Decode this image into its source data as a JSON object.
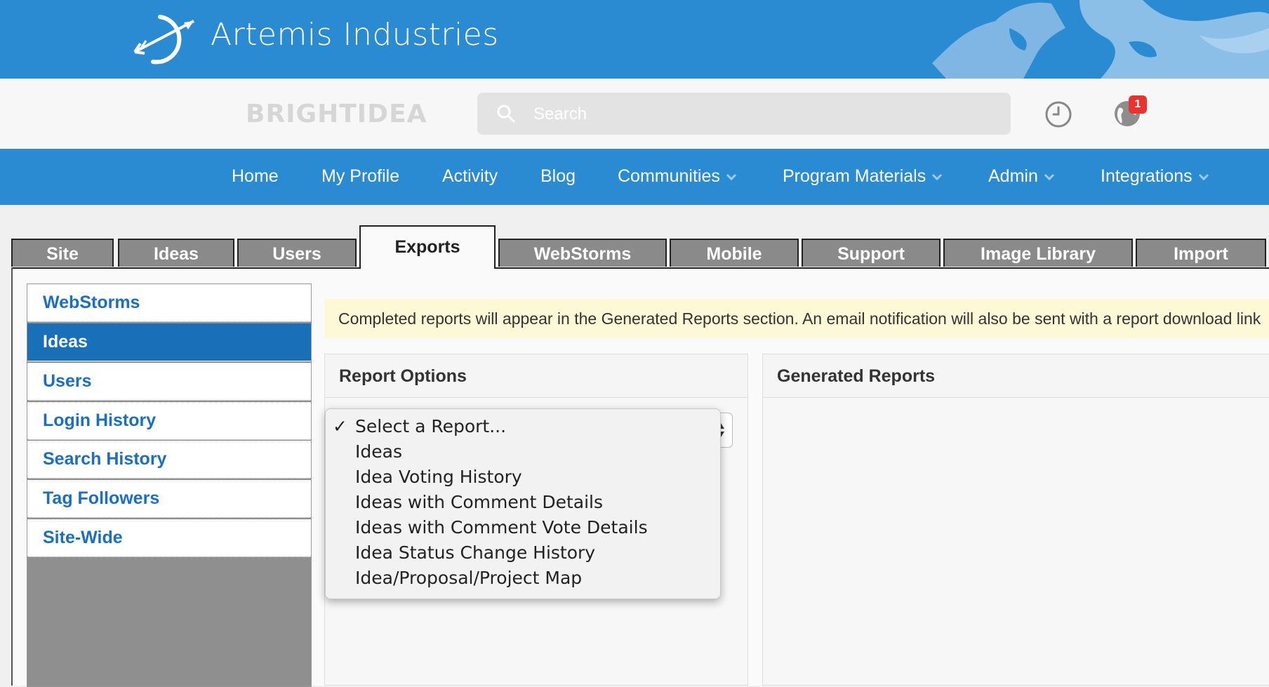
{
  "brand": {
    "title": "Artemis Industries",
    "platform_logo": "BRIGHTIDEA",
    "logo_icon": "arrow-logo-icon"
  },
  "search": {
    "placeholder": "Search"
  },
  "notifications": {
    "count": "1"
  },
  "nav": [
    {
      "label": "Home",
      "dropdown": false
    },
    {
      "label": "My Profile",
      "dropdown": false
    },
    {
      "label": "Activity",
      "dropdown": false
    },
    {
      "label": "Blog",
      "dropdown": false
    },
    {
      "label": "Communities",
      "dropdown": true
    },
    {
      "label": "Program Materials",
      "dropdown": true
    },
    {
      "label": "Admin",
      "dropdown": true
    },
    {
      "label": "Integrations",
      "dropdown": true
    }
  ],
  "tabs": [
    {
      "label": "Site"
    },
    {
      "label": "Ideas"
    },
    {
      "label": "Users"
    },
    {
      "label": "Exports",
      "active": true
    },
    {
      "label": "WebStorms"
    },
    {
      "label": "Mobile"
    },
    {
      "label": "Support"
    },
    {
      "label": "Image Library"
    },
    {
      "label": "Import"
    }
  ],
  "sidemenu": [
    {
      "label": "WebStorms"
    },
    {
      "label": "Ideas",
      "active": true
    },
    {
      "label": "Users"
    },
    {
      "label": "Login History"
    },
    {
      "label": "Search History"
    },
    {
      "label": "Tag Followers"
    },
    {
      "label": "Site-Wide"
    }
  ],
  "notice": "Completed reports will appear in the Generated Reports section. An email notification will also be sent with a report download link",
  "report_options": {
    "title": "Report Options",
    "selected": "Select a Report...",
    "options": [
      "Select a Report...",
      "Ideas",
      "Idea Voting History",
      "Ideas with Comment Details",
      "Ideas with Comment Vote Details",
      "Idea Status Change History",
      "Idea/Proposal/Project Map"
    ]
  },
  "generated_reports": {
    "title": "Generated Reports"
  },
  "colors": {
    "primary": "#2b8bd2",
    "sidebar_active": "#1a6fb9",
    "tab_inactive": "#8a8a8a",
    "notice_bg": "#fdf8d5",
    "badge": "#e8332f"
  }
}
